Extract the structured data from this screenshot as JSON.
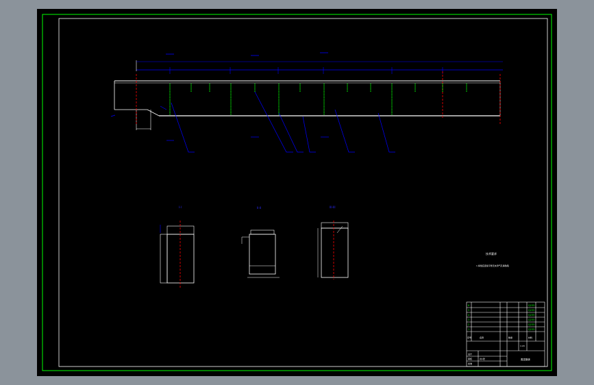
{
  "app": {
    "title": ""
  },
  "colors": {
    "background_outer": "#8b939b",
    "canvas": "#000000",
    "frame_outer": "#00ff00",
    "frame_inner": "#ffffff",
    "dimension": "#0000ff",
    "centerline": "#ff0000",
    "segment_marks": "#00ff00",
    "geometry": "#ffffff"
  },
  "sections": {
    "s1": {
      "label": "I-I"
    },
    "s2": {
      "label": "II-II"
    },
    "s3": {
      "label": "III-III"
    }
  },
  "notes": {
    "title": "技术要求",
    "line1": "1.焊缝应连续平整无夹渣气孔等缺陷"
  },
  "drawing_name": "蒸发箱体",
  "title_block": {
    "rows": [
      {
        "no": "6",
        "name": "—",
        "qty": "1",
        "material": "Q235"
      },
      {
        "no": "5",
        "name": "—",
        "qty": "1",
        "material": "Q235"
      },
      {
        "no": "4",
        "name": "—",
        "qty": "2",
        "material": "Q235"
      },
      {
        "no": "3",
        "name": "—",
        "qty": "1",
        "material": "Q235"
      },
      {
        "no": "2",
        "name": "—",
        "qty": "4",
        "material": "Q235"
      },
      {
        "no": "1",
        "name": "—",
        "qty": "1",
        "material": "Q235"
      }
    ],
    "header": {
      "no": "序号",
      "name": "名称",
      "qty": "数量",
      "material": "材料"
    },
    "design": "设计",
    "check": "审核",
    "approve": "批准",
    "scale": "1:20",
    "sheet": "共1张"
  }
}
